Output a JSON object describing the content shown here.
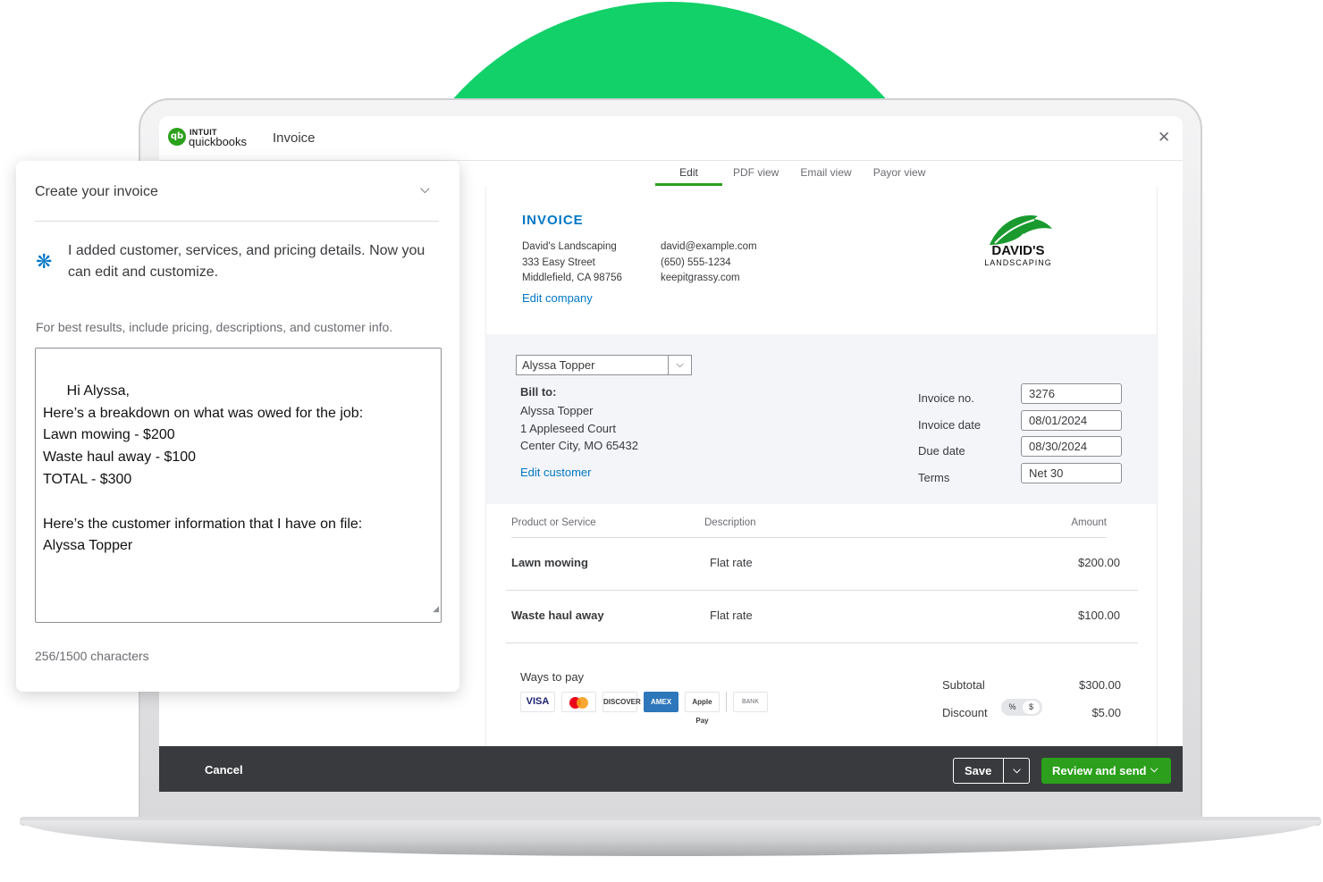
{
  "app": {
    "brand_top": "INTUIT",
    "brand_name": "quickbooks",
    "title": "Invoice",
    "close": "✕"
  },
  "tabs": [
    {
      "label": "Edit",
      "active": true
    },
    {
      "label": "PDF view"
    },
    {
      "label": "Email view"
    },
    {
      "label": "Payor view"
    }
  ],
  "invoice": {
    "heading": "INVOICE",
    "company_lines": [
      "David's Landscaping",
      "333 Easy Street",
      "Middlefield, CA 98756"
    ],
    "contact_lines": [
      "david@example.com",
      "(650) 555-1234",
      "keepitgrassy.com"
    ],
    "edit_company": "Edit company",
    "logo_name": "DAVID'S",
    "logo_sub": "LANDSCAPING",
    "customer_select": "Alyssa Topper",
    "bill_to_label": "Bill to:",
    "bill_to_lines": [
      "Alyssa Topper",
      "1 Appleseed Court",
      "Center City, MO 65432"
    ],
    "edit_customer": "Edit customer",
    "meta": [
      {
        "label": "Invoice no.",
        "value": "3276"
      },
      {
        "label": "Invoice date",
        "value": "08/01/2024"
      },
      {
        "label": "Due date",
        "value": "08/30/2024"
      },
      {
        "label": "Terms",
        "value": "Net 30"
      }
    ],
    "columns": {
      "product": "Product or Service",
      "description": "Description",
      "amount": "Amount"
    },
    "line_items": [
      {
        "product": "Lawn mowing",
        "description": "Flat rate",
        "amount": "$200.00"
      },
      {
        "product": "Waste haul away",
        "description": "Flat rate",
        "amount": "$100.00"
      }
    ],
    "ways_to_pay": "Ways to pay",
    "payment_methods": [
      "VISA",
      "mastercard",
      "DISCOVER",
      "AMEX",
      "Apple Pay",
      "BANK"
    ],
    "subtotal_label": "Subtotal",
    "subtotal_value": "$300.00",
    "discount_label": "Discount",
    "discount_value": "$5.00",
    "discount_toggle": [
      "%",
      "$"
    ]
  },
  "footer": {
    "cancel": "Cancel",
    "save": "Save",
    "review_send": "Review and send"
  },
  "panel": {
    "title": "Create your invoice",
    "message": "I added customer, services, and pricing details. Now you can edit and customize.",
    "hint": "For best results, include pricing, descriptions, and customer info.",
    "textarea": "Hi Alyssa,\nHere’s a breakdown on what was owed for the job:\nLawn mowing - $200\nWaste haul away - $100\nTOTAL - $300\n\nHere’s the customer information that I have on file:\nAlyssa Topper",
    "char_count": "256/1500 characters"
  },
  "colors": {
    "brand_green": "#2ca01c",
    "hero_green": "#12d169",
    "link_blue": "#0077c5",
    "footer_dark": "#393a3d"
  },
  "icons": [
    "qb-logo-icon",
    "close-icon",
    "chevron-down-icon",
    "sparkle-icon",
    "leaf-logo-icon",
    "resize-grip-icon"
  ]
}
